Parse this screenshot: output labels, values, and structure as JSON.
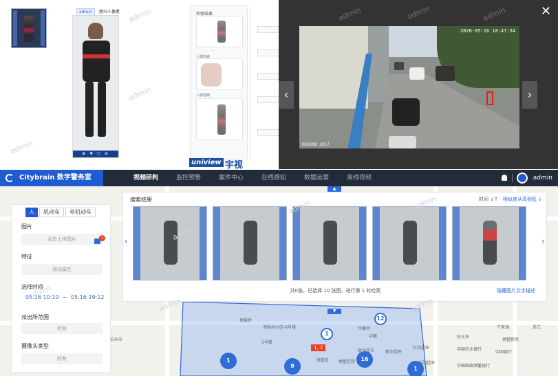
{
  "watermark": "admin",
  "top": {
    "tag_selected": "admin",
    "tag_other": "感兴人像素",
    "uniview_brand": "uniview",
    "uniview_cn": "宇视",
    "side_list": {
      "title": "检索结果",
      "label_1": "人像检索",
      "label_2": "人像检索"
    },
    "video": {
      "timestamp": "2020-05-16 18:47:34",
      "camera": "HS1008 2017"
    },
    "close": "✕",
    "prev": "‹",
    "next": "›"
  },
  "app": {
    "logo": "Citybrain 数字警务室",
    "nav": [
      "视频研判",
      "监控预警",
      "案件中心",
      "在线感知",
      "数据运营",
      "离线视频"
    ],
    "user": "admin",
    "panel": {
      "tabs": [
        "人",
        "机动车",
        "非机动车"
      ],
      "image_label": "图片",
      "upload": "点击上传图片",
      "upload_badge": "1",
      "feature_label": "特征",
      "feature_btn": "添加属性",
      "time_label": "选择时间",
      "time_start": "05.16 10:10",
      "time_sep": "~",
      "time_end": "05.16 19:12",
      "station_label": "派出所范围",
      "station_value": "所有",
      "camera_label": "摄像头类型",
      "camera_value": "所有"
    },
    "results": {
      "title": "搜索结果",
      "sort": "时间 ↓↑",
      "link": "相似度从高到低 ↓",
      "summary": "共0张，已选择 10 张图，进行第 1 轮检索",
      "hide": "隐藏图片文字描述",
      "prev": "‹",
      "next": "›"
    },
    "map": {
      "labels": [
        "拱宸桥",
        "海胜村小区-8号楼",
        "海胜村小区",
        "华都村",
        "华都",
        "海胜村小区 5号楼",
        "杭州市",
        "拱墅区",
        "拱墅区院",
        "天然村",
        "中国农业银行",
        "中国邮政储蓄银行",
        "乐购超市",
        "联华超市",
        "红河超市",
        "新华超市",
        "千家湖",
        "好又多",
        "拱墅新苑",
        "中国银行",
        "乐",
        "浙江",
        "5号楼"
      ],
      "clusters": [
        "1",
        "9",
        "16",
        "12",
        "1",
        "1"
      ],
      "marker": "1, 2"
    }
  }
}
